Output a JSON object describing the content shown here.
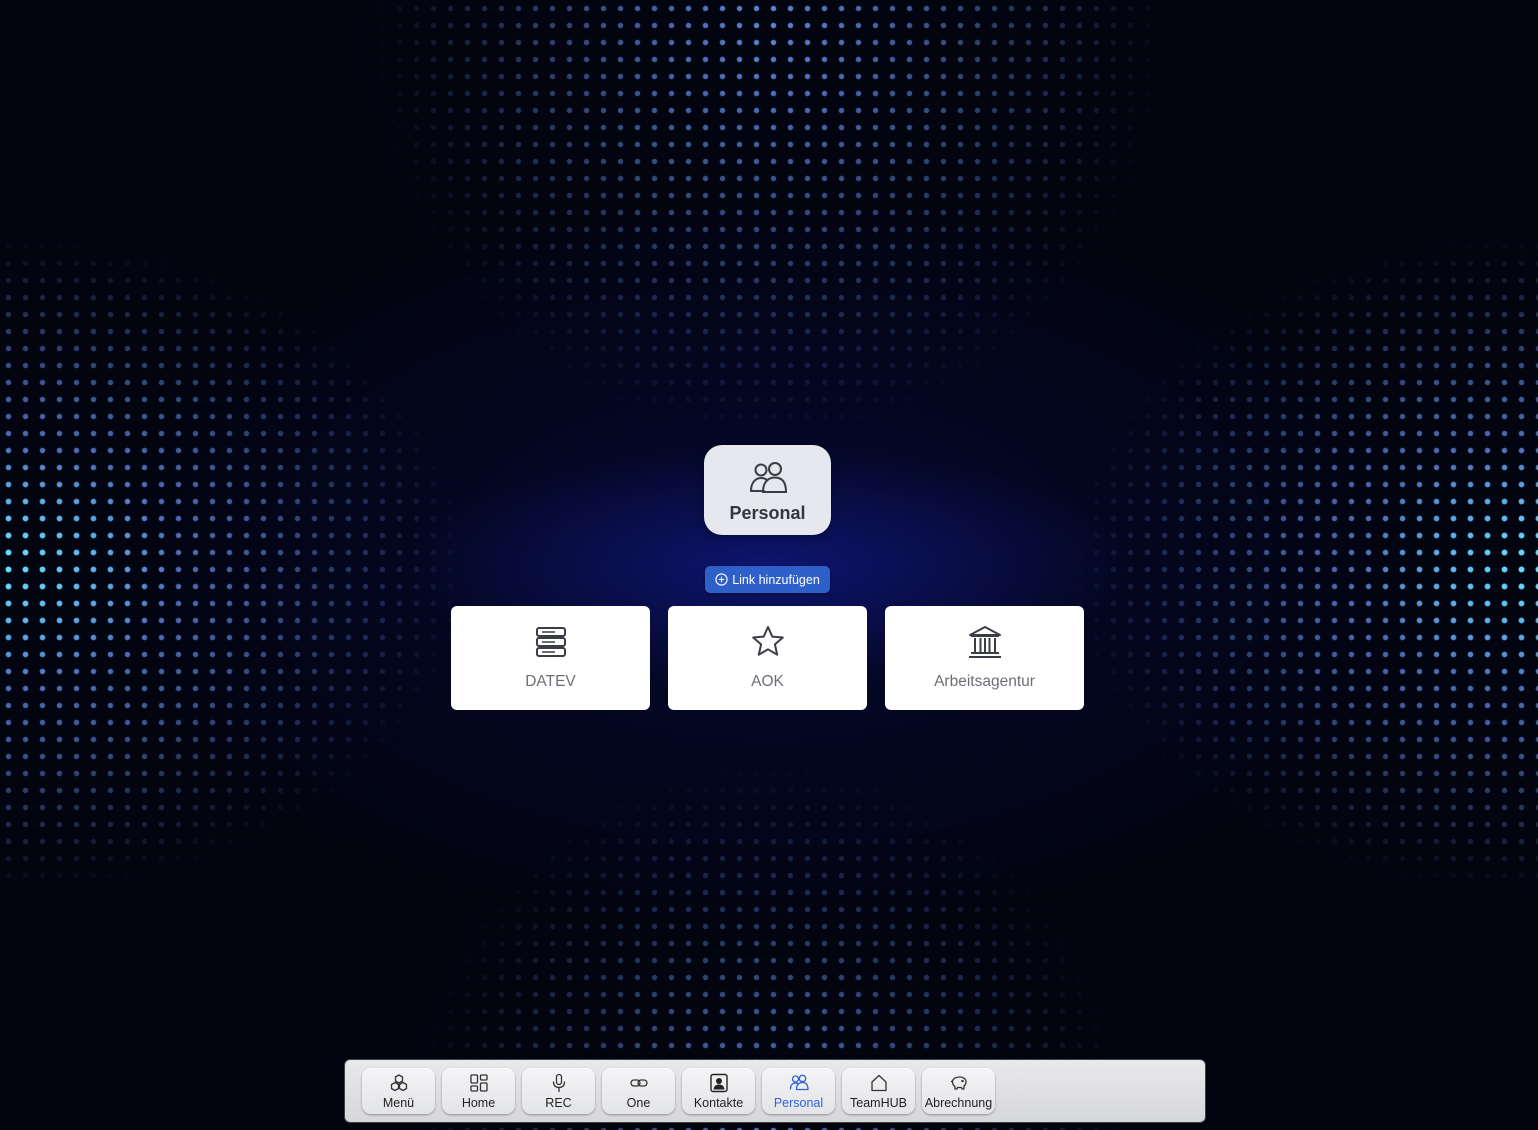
{
  "category": {
    "label": "Personal",
    "icon": "people-icon"
  },
  "add_link_label": "Link hinzufügen",
  "links": [
    {
      "label": "DATEV",
      "icon": "server-icon"
    },
    {
      "label": "AOK",
      "icon": "star-icon"
    },
    {
      "label": "Arbeitsagentur",
      "icon": "bank-building-icon"
    }
  ],
  "dock": {
    "active": "Personal",
    "items": [
      {
        "label": "Menü",
        "icon": "cubes-icon"
      },
      {
        "label": "Home",
        "icon": "grid-icon"
      },
      {
        "label": "REC",
        "icon": "microphone-icon"
      },
      {
        "label": "One",
        "icon": "link-icon"
      },
      {
        "label": "Kontakte",
        "icon": "contact-card-icon"
      },
      {
        "label": "Personal",
        "icon": "people-icon"
      },
      {
        "label": "TeamHUB",
        "icon": "house-icon"
      },
      {
        "label": "Abrechnung",
        "icon": "piggy-bank-icon"
      }
    ]
  },
  "colors": {
    "accent": "#2f5fc8",
    "active_dock_label": "#2f63d6",
    "background": "#02040f",
    "dots": "#6f9dff"
  }
}
